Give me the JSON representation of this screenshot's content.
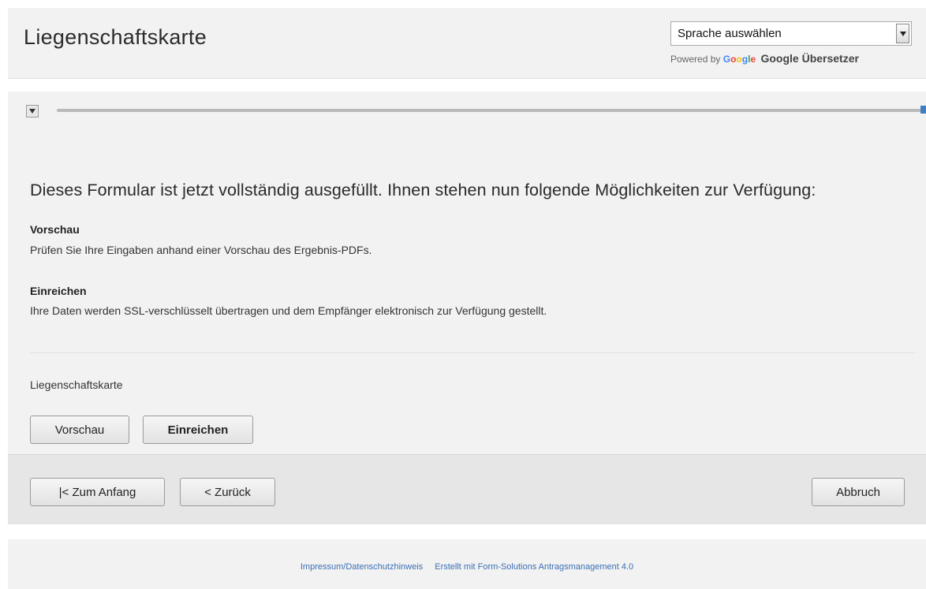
{
  "header": {
    "title": "Liegenschaftskarte",
    "language_select": {
      "value": "Sprache auswählen"
    },
    "powered_by": {
      "prefix": "Powered by",
      "google_letters": [
        "G",
        "o",
        "o",
        "g",
        "l",
        "e"
      ],
      "translate_label": "Google Übersetzer"
    }
  },
  "progress": {
    "fraction": 1.0,
    "accent_color": "#3b7fc4"
  },
  "main": {
    "heading": "Dieses Formular ist jetzt vollständig ausgefüllt. Ihnen stehen nun folgende Möglichkeiten zur Verfügung:",
    "options": [
      {
        "title": "Vorschau",
        "description": "Prüfen Sie Ihre Eingaben anhand einer Vorschau des Ergebnis-PDFs."
      },
      {
        "title": "Einreichen",
        "description": "Ihre Daten werden SSL-verschlüsselt übertragen und dem Empfänger elektronisch zur Verfügung gestellt."
      }
    ],
    "form_name": "Liegenschaftskarte",
    "buttons": {
      "preview": "Vorschau",
      "submit": "Einreichen"
    }
  },
  "nav": {
    "first": "|< Zum Anfang",
    "back": "< Zurück",
    "cancel": "Abbruch"
  },
  "footer": {
    "links": [
      "Impressum/Datenschutzhinweis",
      "Erstellt mit Form-Solutions Antragsmanagement 4.0"
    ]
  }
}
